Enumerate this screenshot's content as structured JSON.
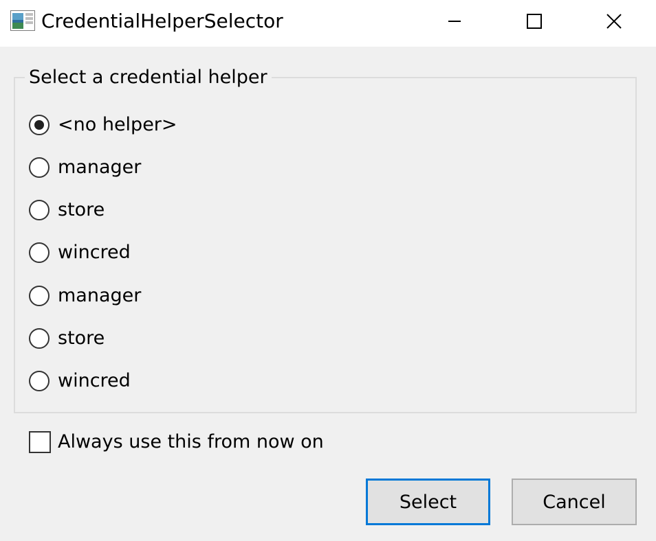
{
  "window": {
    "title": "CredentialHelperSelector",
    "icon": "app-icon",
    "controls": {
      "minimize": "minimize-icon",
      "maximize": "maximize-icon",
      "close": "close-icon"
    }
  },
  "group": {
    "legend": "Select a credential helper",
    "options": [
      {
        "label": "<no helper>",
        "checked": true
      },
      {
        "label": "manager",
        "checked": false
      },
      {
        "label": "store",
        "checked": false
      },
      {
        "label": "wincred",
        "checked": false
      },
      {
        "label": "manager",
        "checked": false
      },
      {
        "label": "store",
        "checked": false
      },
      {
        "label": "wincred",
        "checked": false
      }
    ]
  },
  "always_use": {
    "label": "Always use this from now on",
    "checked": false
  },
  "buttons": {
    "select_label": "Select",
    "cancel_label": "Cancel"
  },
  "colors": {
    "focus_accent": "#0078d7",
    "background": "#f0f0f0"
  }
}
